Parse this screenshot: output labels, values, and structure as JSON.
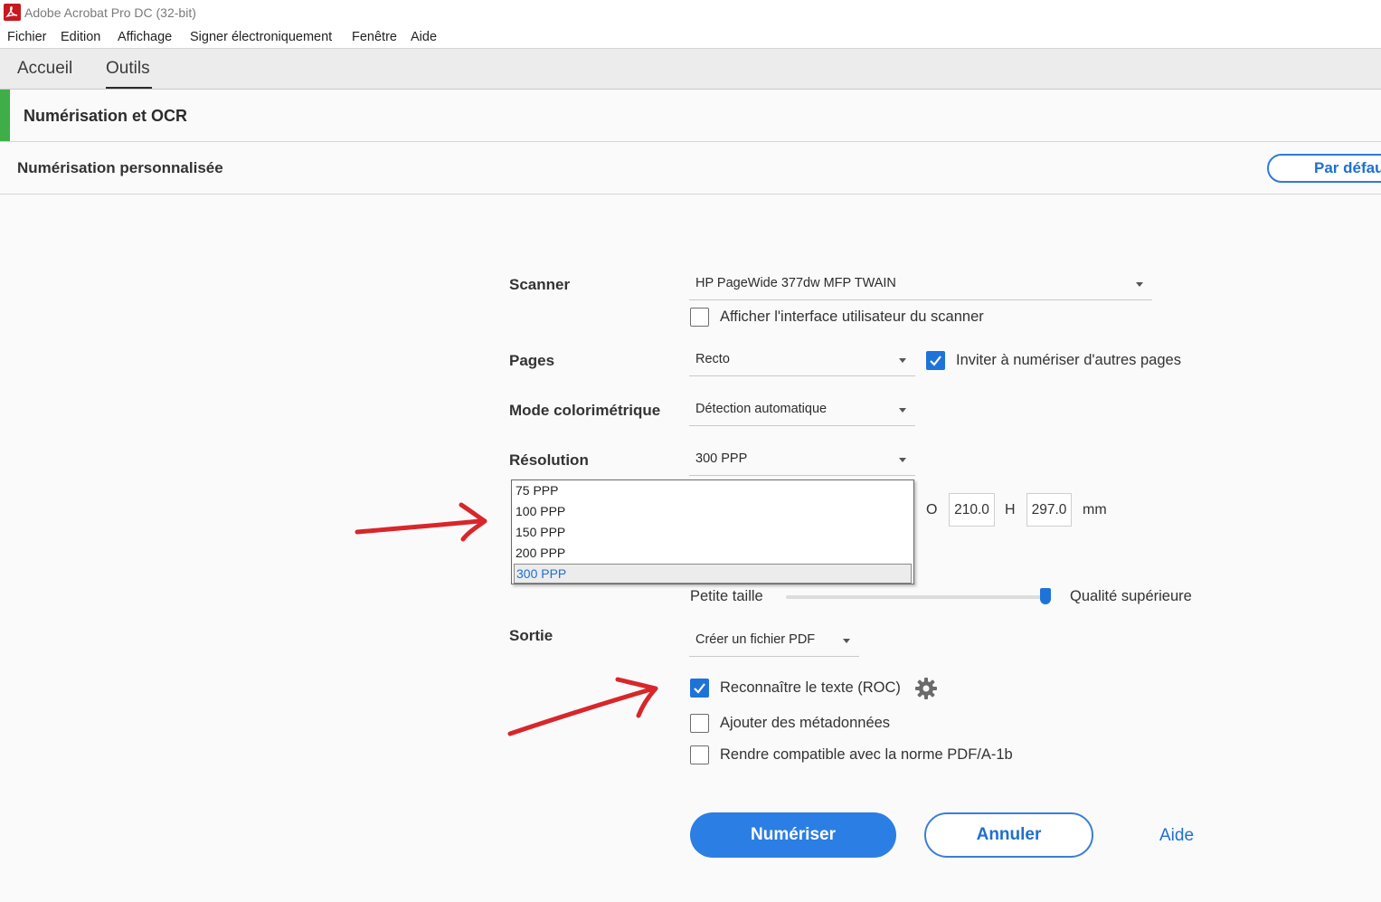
{
  "window": {
    "title": "Adobe Acrobat Pro DC (32-bit)"
  },
  "menu": [
    "Fichier",
    "Edition",
    "Affichage",
    "Signer électroniquement",
    "Fenêtre",
    "Aide"
  ],
  "tabs": [
    "Accueil",
    "Outils"
  ],
  "tool": {
    "title": "Numérisation et OCR"
  },
  "scan": {
    "title": "Numérisation personnalisée",
    "default_button": "Par défaut"
  },
  "form": {
    "scanner_label": "Scanner",
    "scanner_value": "HP PageWide 377dw MFP TWAIN",
    "show_ui_label": "Afficher l'interface utilisateur du scanner",
    "pages_label": "Pages",
    "pages_value": "Recto",
    "prompt_more_label": "Inviter à numériser d'autres pages",
    "color_label": "Mode colorimétrique",
    "color_value": "Détection automatique",
    "resolution_label": "Résolution",
    "resolution_value": "300 PPP",
    "resolution_options": [
      "75 PPP",
      "100 PPP",
      "150 PPP",
      "200 PPP",
      "300 PPP"
    ],
    "size_prefix": "O",
    "width": "210.0",
    "height_label": "H",
    "height": "297.0",
    "unit": "mm",
    "small_size_label": "Petite taille",
    "high_quality_label": "Qualité supérieure",
    "quality_level": 0.98,
    "output_label": "Sortie",
    "output_value": "Créer un fichier PDF",
    "ocr_label": "Reconnaître le texte (ROC)",
    "metadata_label": "Ajouter des métadonnées",
    "pdfa_label": "Rendre compatible avec la norme PDF/A-1b"
  },
  "actions": {
    "scan": "Numériser",
    "cancel": "Annuler",
    "help": "Aide"
  },
  "colors": {
    "accent_green": "#3fae49",
    "primary_blue": "#2b7ee3",
    "annotation_red": "#d8262a"
  }
}
